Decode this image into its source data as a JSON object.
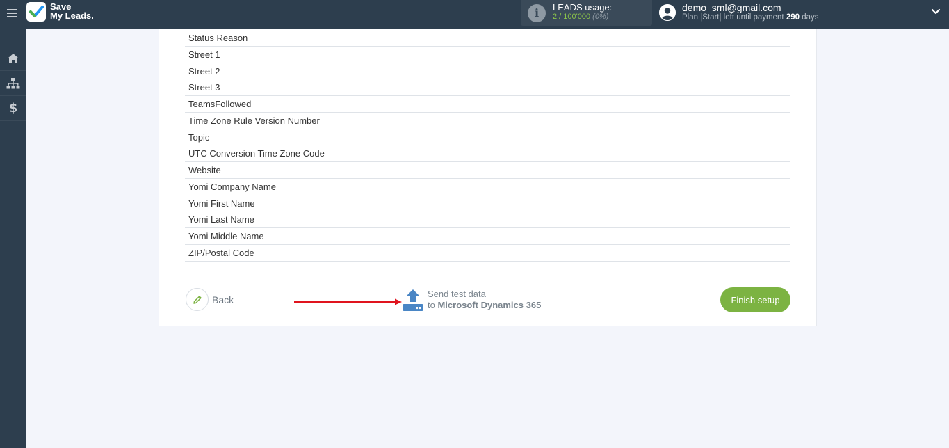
{
  "header": {
    "logo_line1": "Save",
    "logo_line2": "My Leads.",
    "usage_label": "LEADS usage:",
    "usage_count": "2 / 100'000",
    "usage_percent": "(0%)",
    "user_email": "demo_sml@gmail.com",
    "plan_prefix": "Plan |Start| left until payment ",
    "plan_days": "290",
    "plan_suffix": " days"
  },
  "sidebar": {
    "items": [
      {
        "icon": "home-icon"
      },
      {
        "icon": "sitemap-icon"
      },
      {
        "icon": "dollar-icon"
      }
    ]
  },
  "fields": [
    "Status Reason",
    "Street 1",
    "Street 2",
    "Street 3",
    "TeamsFollowed",
    "Time Zone Rule Version Number",
    "Topic",
    "UTC Conversion Time Zone Code",
    "Website",
    "Yomi Company Name",
    "Yomi First Name",
    "Yomi Last Name",
    "Yomi Middle Name",
    "ZIP/Postal Code"
  ],
  "actions": {
    "back_label": "Back",
    "send_line1": "Send test data",
    "send_prefix": "to ",
    "send_target": "Microsoft Dynamics 365",
    "finish_label": "Finish setup"
  },
  "colors": {
    "topbar": "#2d3e4e",
    "accent_green": "#7cb342",
    "arrow_red": "#e0141e",
    "upload_blue": "#4a86c5"
  }
}
